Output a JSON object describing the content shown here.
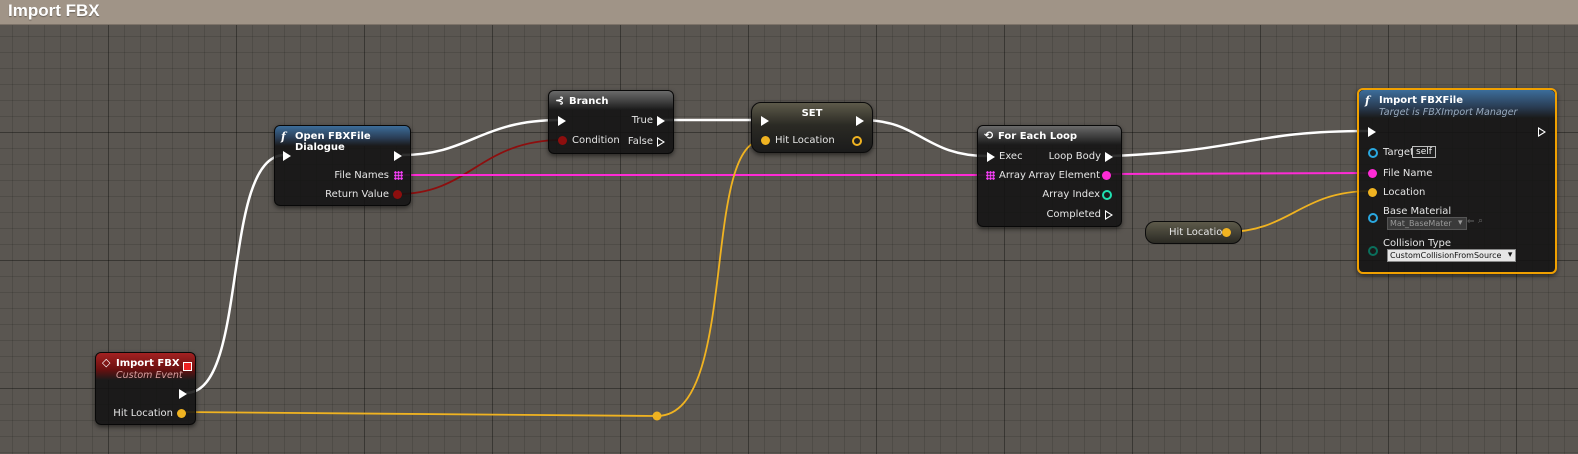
{
  "title": "Import FBX",
  "nodes": {
    "event": {
      "title": "Import FBX",
      "subtitle": "Custom Event",
      "pin_hit": "Hit Location"
    },
    "open": {
      "title": "Open FBXFile Dialogue",
      "pin_files": "File Names",
      "pin_return": "Return Value"
    },
    "branch": {
      "title": "Branch",
      "pin_condition": "Condition",
      "pin_true": "True",
      "pin_false": "False"
    },
    "set": {
      "title": "SET",
      "pin_hit": "Hit Location"
    },
    "foreach": {
      "title": "For Each Loop",
      "pin_exec": "Exec",
      "pin_array": "Array",
      "pin_loop_body": "Loop Body",
      "pin_array_element": "Array Element",
      "pin_array_index": "Array Index",
      "pin_completed": "Completed"
    },
    "var": {
      "label": "Hit Location"
    },
    "import": {
      "title": "Import FBXFile",
      "subtitle": "Target is FBXImport Manager",
      "pin_target": "Target",
      "target_value": "self",
      "pin_file": "File Name",
      "pin_location": "Location",
      "pin_material": "Base Material",
      "material_value": "Mat_BaseMater",
      "pin_collision": "Collision Type",
      "collision_value": "CustomCollisionFromSource"
    }
  },
  "colors": {
    "exec": "#ffffff",
    "vector": "#f0b321",
    "bool": "#8d0e0e",
    "string_array": "#ff2bd6",
    "int": "#1fe0b0",
    "object": "#2aa8e0",
    "enum": "#0a6f5c",
    "selected": "#f0a000"
  },
  "icons": {
    "function": "f-icon",
    "branch": "branch-icon",
    "event": "event-diamond-icon",
    "loop": "loop-icon"
  }
}
